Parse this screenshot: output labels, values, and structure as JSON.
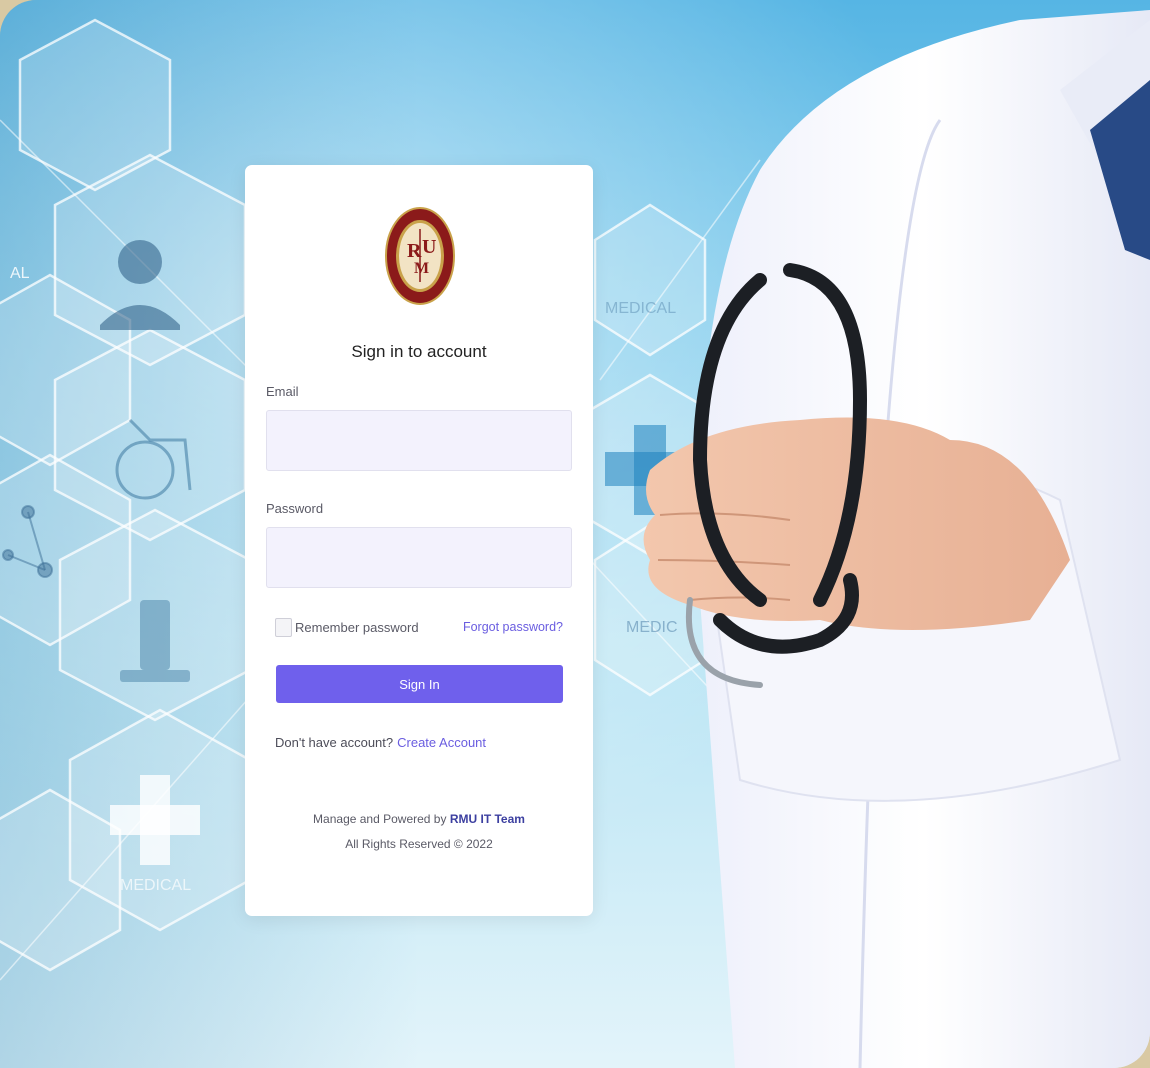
{
  "login": {
    "title": "Sign in to account",
    "email_label": "Email",
    "email_value": "",
    "password_label": "Password",
    "password_value": "",
    "remember_label": "Remember password",
    "forgot_label": "Forgot password?",
    "signin_label": "Sign In",
    "no_account_text": "Don't have account?",
    "create_account_label": "Create Account"
  },
  "footer": {
    "powered_prefix": "Manage and Powered by",
    "powered_team": "RMU IT Team",
    "rights": "All Rights Reserved © 2022"
  },
  "logo": {
    "initials_r": "R",
    "initials_m": "M",
    "initials_u": "U",
    "ring_text": "RAWALPINDI MEDICAL UNIVERSITY"
  },
  "background": {
    "hex_labels": [
      "MEDICAL",
      "MEDICAL",
      "MEDIC",
      "MEDICAL",
      "AL"
    ]
  },
  "colors": {
    "accent": "#6f60ec",
    "link": "#6a5de0",
    "input_bg": "#f3f2fd",
    "logo_red": "#8b1a1a",
    "logo_gold": "#c9a24a"
  }
}
